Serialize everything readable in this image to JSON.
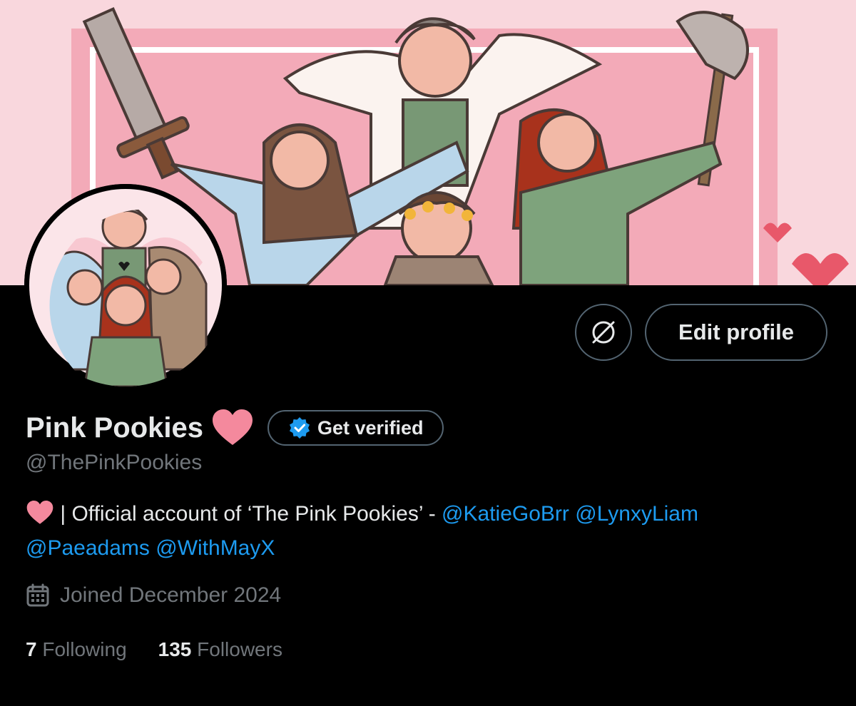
{
  "profile": {
    "display_name": "Pink Pookies",
    "handle": "@ThePinkPookies",
    "get_verified_label": "Get verified",
    "edit_profile_label": "Edit profile",
    "bio": {
      "separator": " | ",
      "text": "Official account of ‘The Pink Pookies’ - ",
      "mentions": [
        "@KatieGoBrr",
        "@LynxyLiam",
        "@Paeadams",
        "@WithMayX"
      ]
    },
    "joined": "Joined December 2024",
    "following_count": "7",
    "following_label": "Following",
    "followers_count": "135",
    "followers_label": "Followers"
  },
  "icons": {
    "heart": "heart-icon",
    "verified_badge": "verified-badge-icon",
    "circle_slash": "circle-slash-icon",
    "calendar": "calendar-icon"
  },
  "colors": {
    "background": "#000000",
    "text_primary": "#e7e9ea",
    "text_secondary": "#71767b",
    "link": "#1d9bf0",
    "heart": "#f4899d",
    "border": "#536471",
    "banner_pink": "#f7c9d2"
  }
}
